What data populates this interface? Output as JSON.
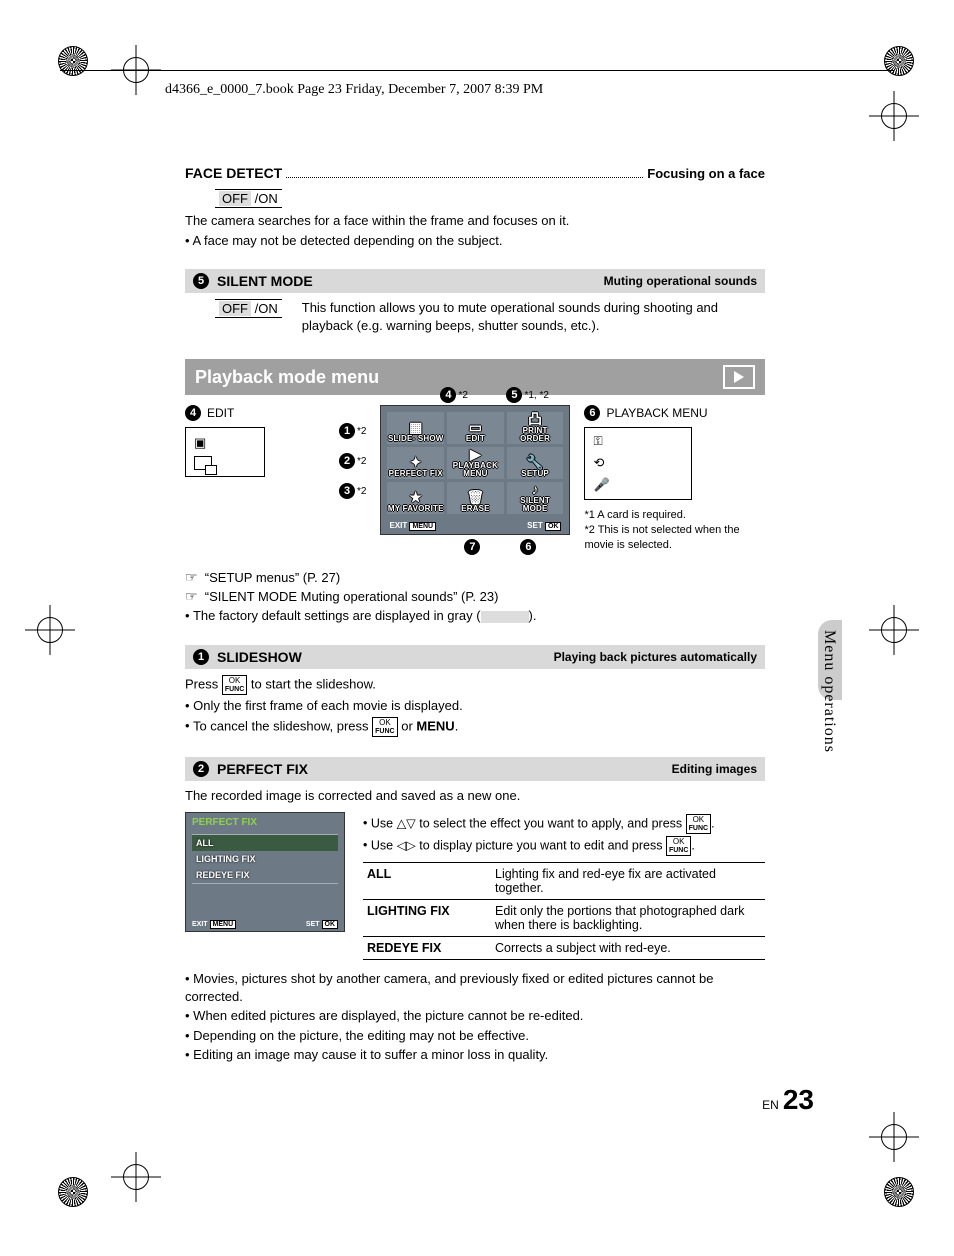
{
  "header": "d4366_e_0000_7.book  Page 23  Friday, December 7, 2007  8:39 PM",
  "face_detect": {
    "title": "FACE DETECT",
    "subtitle": "Focusing on a face",
    "opt_off": "OFF",
    "opt_on": "/ON",
    "desc": "The camera searches for a face within the frame and focuses on it.",
    "note": "A face may not be detected depending on the subject."
  },
  "silent": {
    "num": "5",
    "title": "SILENT MODE",
    "subtitle": "Muting operational sounds",
    "opt_off": "OFF",
    "opt_on": "/ON",
    "desc": "This function allows you to mute operational sounds during shooting and playback (e.g. warning beeps, shutter sounds, etc.)."
  },
  "playback": {
    "title": "Playback mode menu",
    "edit_num": "4",
    "edit_label": "EDIT",
    "pm_num": "6",
    "pm_label": "PLAYBACK MENU",
    "anno1": "*2",
    "anno2": "*2",
    "anno3": "*2",
    "top4": "*2",
    "top5": "*1, *2",
    "menu": {
      "c1": "SLIDE-\nSHOW",
      "c2": "EDIT",
      "c3": "PRINT\nORDER",
      "c4": "PERFECT\nFIX",
      "c5": "PLAYBACK\nMENU",
      "c6": "SETUP",
      "c7": "MY\nFAVORITE",
      "c8": "ERASE",
      "c9": "SILENT\nMODE",
      "exit": "EXIT",
      "exit_btn": "MENU",
      "set": "SET",
      "set_btn": "OK"
    },
    "fn1": "*1 A card is required.",
    "fn2": "*2 This is not selected when the movie is selected.",
    "ref1": "“SETUP menus” (P. 27)",
    "ref2": "“SILENT MODE Muting operational sounds” (P. 23)",
    "default_note_a": "The factory default settings are displayed in gray (",
    "default_note_b": ")."
  },
  "slideshow": {
    "num": "1",
    "title": "SLIDESHOW",
    "subtitle": "Playing back pictures automatically",
    "press": "Press ",
    "press2": " to start the slideshow.",
    "b1": "Only the first frame of each movie is displayed.",
    "b2a": "To cancel the slideshow, press ",
    "b2b": " or ",
    "b2c": "MENU",
    "b2d": "."
  },
  "perfect": {
    "num": "2",
    "title": "PERFECT FIX",
    "subtitle": "Editing images",
    "intro": "The recorded image is corrected and saved as a new one.",
    "screen_title": "PERFECT FIX",
    "items": [
      "ALL",
      "LIGHTING FIX",
      "REDEYE FIX"
    ],
    "exit": "EXIT",
    "exit_btn": "MENU",
    "set": "SET",
    "set_btn": "OK",
    "use1a": "Use ",
    "use1b": " to select the effect you want to apply, and press ",
    "use1c": ".",
    "use2a": "Use ",
    "use2b": " to display picture you want to edit and press ",
    "use2c": ".",
    "table": {
      "r1k": "ALL",
      "r1v": "Lighting fix and red-eye fix are activated together.",
      "r2k": "LIGHTING FIX",
      "r2v": "Edit only the portions that photographed dark when there is backlighting.",
      "r3k": "REDEYE FIX",
      "r3v": "Corrects a subject with red-eye."
    },
    "notes": [
      "Movies, pictures shot by another camera, and previously fixed or edited pictures cannot be corrected.",
      "When edited pictures are displayed, the picture cannot be re-edited.",
      "Depending on the picture, the editing may not be effective.",
      "Editing an image may cause it to suffer a minor loss in quality."
    ]
  },
  "side_tab": "Menu operations",
  "page": {
    "lang": "EN",
    "num": "23"
  },
  "ok_label_top": "OK",
  "ok_label_bot": "FUNC"
}
